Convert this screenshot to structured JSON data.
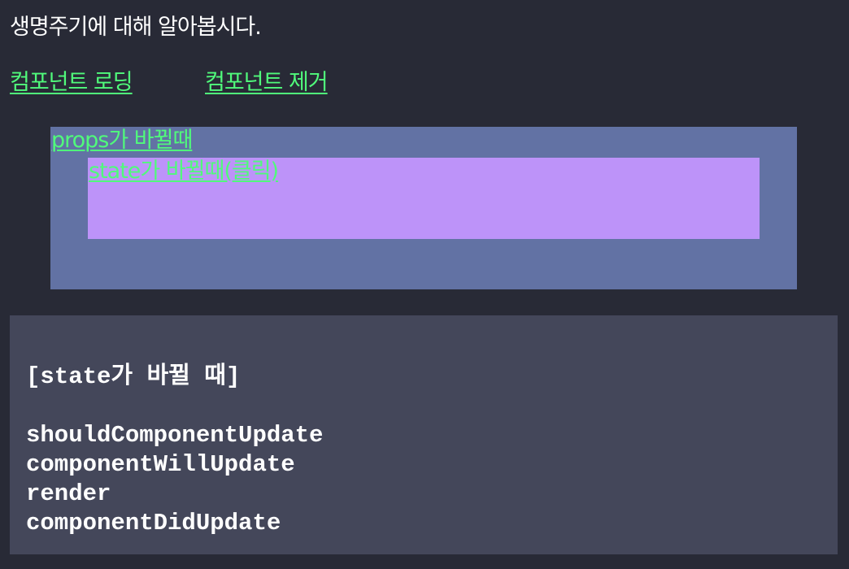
{
  "page": {
    "title": "생명주기에 대해 알아봅시다."
  },
  "nav": {
    "load_label": "컴포넌트 로딩",
    "remove_label": "컴포넌트 제거"
  },
  "props_box": {
    "link_label": "props가 바뀔때",
    "state_box": {
      "link_label": "state가 바뀔때(클릭)"
    }
  },
  "log": {
    "heading": "[state가 바뀔 때]",
    "lines": [
      "shouldComponentUpdate",
      "componentWillUpdate",
      "render",
      "componentDidUpdate"
    ]
  },
  "colors": {
    "background": "#282a36",
    "link": "#50fa7b",
    "props_box": "#6272a4",
    "state_box": "#bd93f9",
    "log_panel": "#44475a",
    "text": "#ffffff"
  }
}
